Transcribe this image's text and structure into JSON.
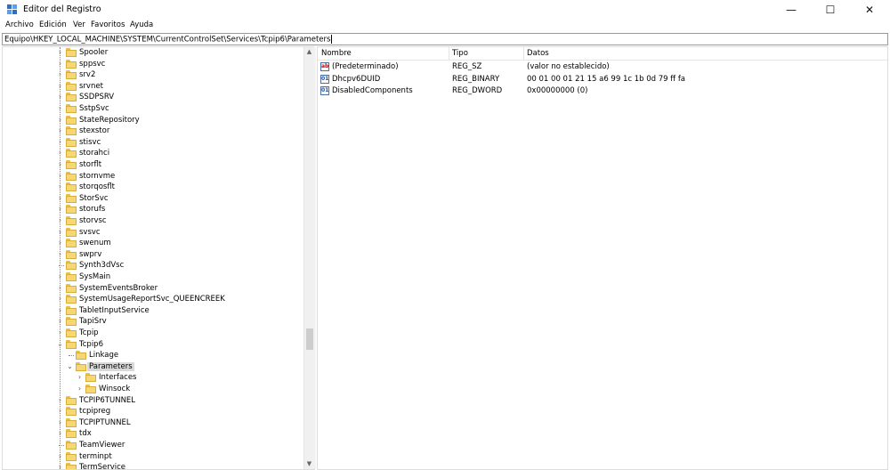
{
  "window": {
    "title": "Editor del Registro",
    "minimize_glyph": "—",
    "maximize_glyph": "☐",
    "close_glyph": "✕"
  },
  "menu": [
    "Archivo",
    "Edición",
    "Ver",
    "Favoritos",
    "Ayuda"
  ],
  "address": {
    "path": "Equipo\\HKEY_LOCAL_MACHINE\\SYSTEM\\CurrentControlSet\\Services\\Tcpip6\\Parameters"
  },
  "tree": {
    "nodes": [
      {
        "label": "Spooler",
        "depth": 0,
        "expander": "›"
      },
      {
        "label": "sppsvc",
        "depth": 0,
        "expander": "›"
      },
      {
        "label": "srv2",
        "depth": 0,
        "expander": "›"
      },
      {
        "label": "srvnet",
        "depth": 0,
        "expander": "›"
      },
      {
        "label": "SSDPSRV",
        "depth": 0,
        "expander": "›"
      },
      {
        "label": "SstpSvc",
        "depth": 0,
        "expander": "›"
      },
      {
        "label": "StateRepository",
        "depth": 0,
        "expander": "›"
      },
      {
        "label": "stexstor",
        "depth": 0,
        "expander": "›"
      },
      {
        "label": "stisvc",
        "depth": 0,
        "expander": "›"
      },
      {
        "label": "storahci",
        "depth": 0,
        "expander": "›"
      },
      {
        "label": "storflt",
        "depth": 0,
        "expander": "›"
      },
      {
        "label": "stornvme",
        "depth": 0,
        "expander": "›"
      },
      {
        "label": "storqosflt",
        "depth": 0,
        "expander": "›"
      },
      {
        "label": "StorSvc",
        "depth": 0,
        "expander": "›"
      },
      {
        "label": "storufs",
        "depth": 0,
        "expander": "›"
      },
      {
        "label": "storvsc",
        "depth": 0,
        "expander": "›"
      },
      {
        "label": "svsvc",
        "depth": 0,
        "expander": "›"
      },
      {
        "label": "swenum",
        "depth": 0,
        "expander": "›"
      },
      {
        "label": "swprv",
        "depth": 0,
        "expander": "›"
      },
      {
        "label": "Synth3dVsc",
        "depth": 0,
        "expander": ""
      },
      {
        "label": "SysMain",
        "depth": 0,
        "expander": "›"
      },
      {
        "label": "SystemEventsBroker",
        "depth": 0,
        "expander": "›"
      },
      {
        "label": "SystemUsageReportSvc_QUEENCREEK",
        "depth": 0,
        "expander": "›"
      },
      {
        "label": "TabletInputService",
        "depth": 0,
        "expander": "›"
      },
      {
        "label": "TapiSrv",
        "depth": 0,
        "expander": "›"
      },
      {
        "label": "Tcpip",
        "depth": 0,
        "expander": "›"
      },
      {
        "label": "Tcpip6",
        "depth": 0,
        "expander": "⌄"
      },
      {
        "label": "Linkage",
        "depth": 1,
        "expander": ""
      },
      {
        "label": "Parameters",
        "depth": 1,
        "expander": "⌄",
        "selected": true
      },
      {
        "label": "Interfaces",
        "depth": 2,
        "expander": "›"
      },
      {
        "label": "Winsock",
        "depth": 2,
        "expander": "›"
      },
      {
        "label": "TCPIP6TUNNEL",
        "depth": 0,
        "expander": "›"
      },
      {
        "label": "tcpipreg",
        "depth": 0,
        "expander": "›"
      },
      {
        "label": "TCPIPTUNNEL",
        "depth": 0,
        "expander": "›"
      },
      {
        "label": "tdx",
        "depth": 0,
        "expander": "›"
      },
      {
        "label": "TeamViewer",
        "depth": 0,
        "expander": ""
      },
      {
        "label": "terminpt",
        "depth": 0,
        "expander": "›"
      },
      {
        "label": "TermService",
        "depth": 0,
        "expander": "›"
      }
    ]
  },
  "list": {
    "headers": {
      "name": "Nombre",
      "type": "Tipo",
      "data": "Datos"
    },
    "rows": [
      {
        "name": "(Predeterminado)",
        "type": "REG_SZ",
        "data": "(valor no establecido)",
        "icon": "string-value-icon",
        "icon_glyph": "ab"
      },
      {
        "name": "Dhcpv6DUID",
        "type": "REG_BINARY",
        "data": "00 01 00 01 21 15 a6 99 1c 1b 0d 79 ff fa",
        "icon": "binary-value-icon",
        "icon_glyph": "01"
      },
      {
        "name": "DisabledComponents",
        "type": "REG_DWORD",
        "data": "0x00000000 (0)",
        "icon": "binary-value-icon",
        "icon_glyph": "01"
      }
    ]
  },
  "colors": {
    "selection": "#d9d9d9",
    "folder": "#f7d774"
  }
}
